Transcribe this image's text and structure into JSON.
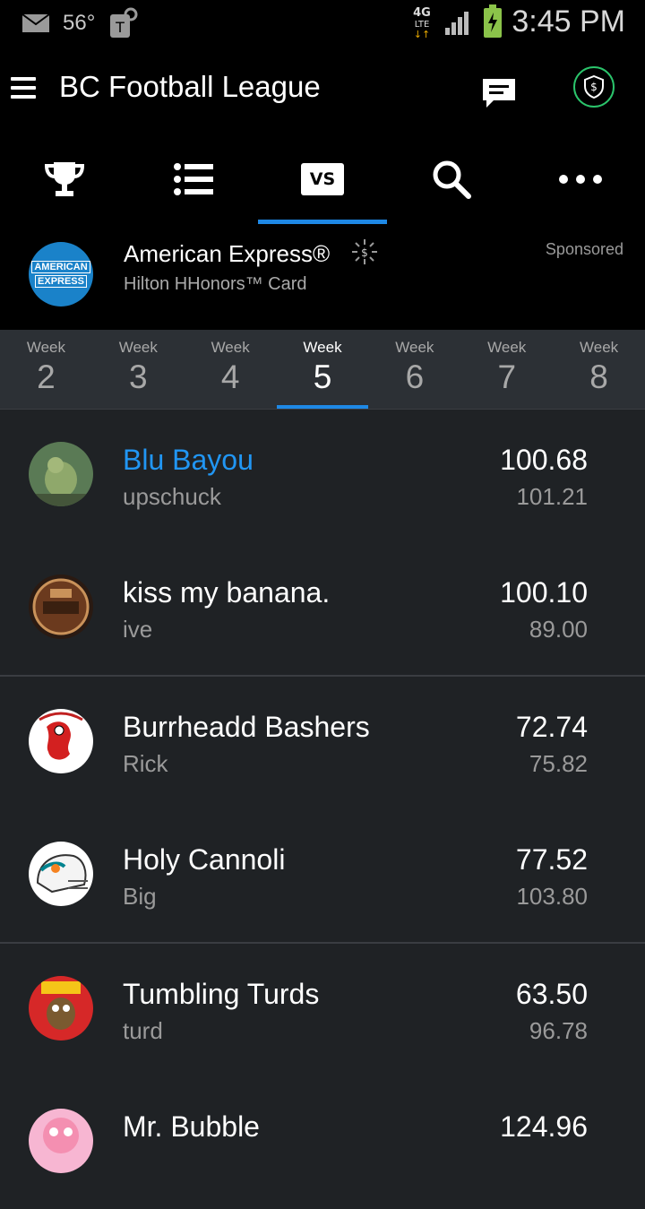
{
  "status_bar": {
    "temperature": "56",
    "network": "4G LTE",
    "time": "3:45 PM"
  },
  "header": {
    "title": "BC Football League"
  },
  "tabs": [
    {
      "name": "trophy-icon"
    },
    {
      "name": "list-icon"
    },
    {
      "name": "vs-icon",
      "label": "VS",
      "active": true
    },
    {
      "name": "search-icon"
    },
    {
      "name": "more-icon"
    }
  ],
  "ad": {
    "logo_line1": "AMERICAN",
    "logo_line2": "EXPRESS",
    "title": "American Express®",
    "subtitle": "Hilton HHonors™ Card",
    "sponsored": "Sponsored"
  },
  "weeks": [
    {
      "label": "Week",
      "number": "2"
    },
    {
      "label": "Week",
      "number": "3"
    },
    {
      "label": "Week",
      "number": "4"
    },
    {
      "label": "Week",
      "number": "5",
      "active": true
    },
    {
      "label": "Week",
      "number": "6"
    },
    {
      "label": "Week",
      "number": "7"
    },
    {
      "label": "Week",
      "number": "8"
    }
  ],
  "matchups": [
    {
      "team1": {
        "name": "Blu Bayou",
        "owner": "upschuck",
        "score": "100.68",
        "projected": "101.21"
      },
      "team2": {
        "name": "kiss my banana.",
        "owner": "ive",
        "score": "100.10",
        "projected": "89.00"
      }
    },
    {
      "team1": {
        "name": "Burrheadd Bashers",
        "owner": "Rick",
        "score": "72.74",
        "projected": "75.82"
      },
      "team2": {
        "name": "Holy Cannoli",
        "owner": "Big",
        "score": "77.52",
        "projected": "103.80"
      }
    },
    {
      "team1": {
        "name": "Tumbling Turds",
        "owner": "turd",
        "score": "63.50",
        "projected": "96.78"
      },
      "team2": {
        "name": "Mr. Bubble",
        "owner": "",
        "score": "124.96",
        "projected": ""
      }
    }
  ],
  "colors": {
    "accent": "#1e88e5",
    "highlight_team": "#2196f3",
    "shield": "#2bc46b"
  }
}
